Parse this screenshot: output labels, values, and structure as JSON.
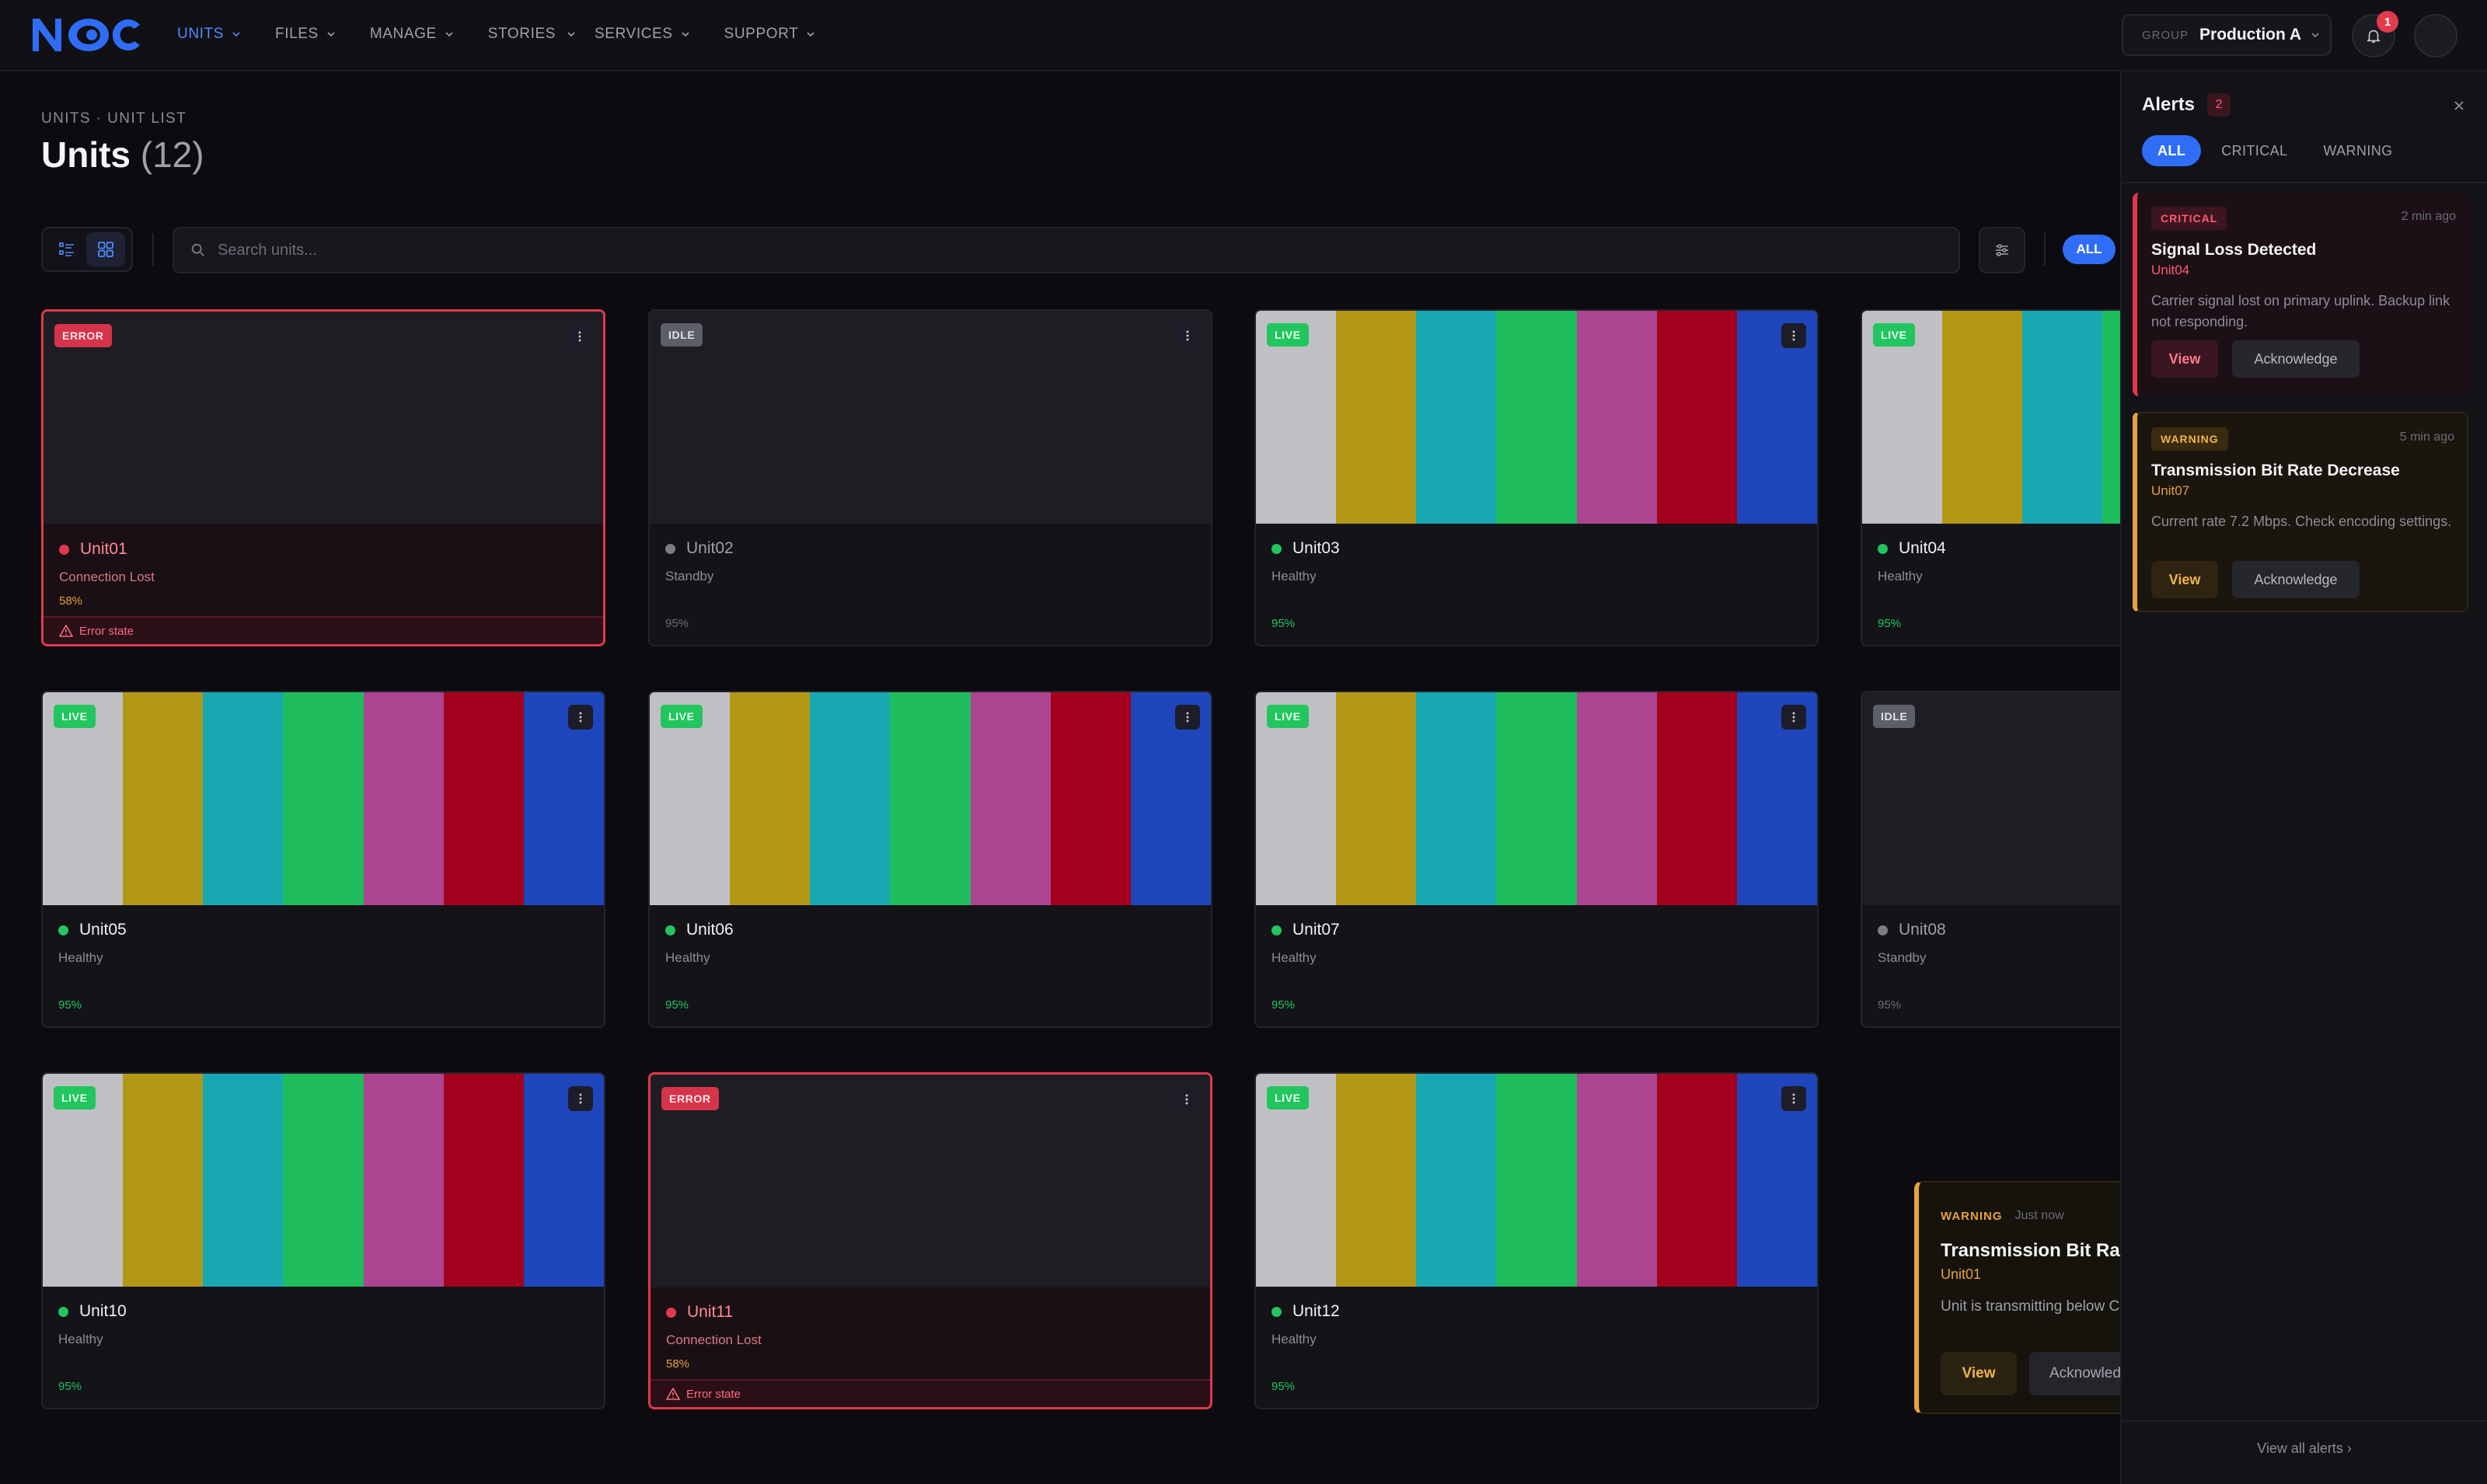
{
  "nav": {
    "logo_text": "NOC",
    "items": [
      {
        "label": "UNITS",
        "active": true
      },
      {
        "label": "FILES"
      },
      {
        "label": "MANAGE"
      },
      {
        "label": "STORIES"
      },
      {
        "label": "SERVICES"
      },
      {
        "label": "SUPPORT"
      }
    ],
    "group_label": "GROUP",
    "group_value": "Production A",
    "notification_count": "1"
  },
  "page": {
    "breadcrumb": "UNITS · UNIT LIST",
    "title": "Units",
    "count": "(12)"
  },
  "toolbar": {
    "search_placeholder": "Search units...",
    "filter_chip": "ALL"
  },
  "units": [
    {
      "name": "Unit01",
      "status": "Connection Lost",
      "pct": "58%",
      "badge": "ERROR",
      "state": "error",
      "error_text": "Error state"
    },
    {
      "name": "Unit02",
      "status": "Standby",
      "pct": "95%",
      "badge": "IDLE",
      "state": "idle"
    },
    {
      "name": "Unit03",
      "status": "Healthy",
      "pct": "95%",
      "badge": "LIVE",
      "state": "live"
    },
    {
      "name": "Unit04",
      "status": "Healthy",
      "pct": "95%",
      "badge": "LIVE",
      "state": "live"
    },
    {
      "name": "Unit05",
      "status": "Healthy",
      "pct": "95%",
      "badge": "LIVE",
      "state": "live"
    },
    {
      "name": "Unit06",
      "status": "Healthy",
      "pct": "95%",
      "badge": "LIVE",
      "state": "live"
    },
    {
      "name": "Unit07",
      "status": "Healthy",
      "pct": "95%",
      "badge": "LIVE",
      "state": "live"
    },
    {
      "name": "Unit08",
      "status": "Standby",
      "pct": "95%",
      "badge": "IDLE",
      "state": "idle"
    },
    {
      "name": "Unit10",
      "status": "Healthy",
      "pct": "95%",
      "badge": "LIVE",
      "state": "live"
    },
    {
      "name": "Unit11",
      "status": "Connection Lost",
      "pct": "58%",
      "badge": "ERROR",
      "state": "error",
      "error_text": "Error state"
    },
    {
      "name": "Unit12",
      "status": "Healthy",
      "pct": "95%",
      "badge": "LIVE",
      "state": "live"
    }
  ],
  "color_bars": [
    "#c0c0c4",
    "#b39816",
    "#17a8b3",
    "#1fbd5c",
    "#ad4491",
    "#a3001d",
    "#1f46bd"
  ],
  "toast": {
    "tag": "WARNING",
    "time": "Just now",
    "title": "Transmission Bit Rate",
    "unit": "Unit01",
    "body": "Unit is transmitting below Check connections or enc",
    "view_label": "View",
    "ack_label": "Acknowled"
  },
  "alerts": {
    "title": "Alerts",
    "count": "2",
    "tabs": [
      "ALL",
      "CRITICAL",
      "WARNING"
    ],
    "items": [
      {
        "tag": "CRITICAL",
        "time": "2 min ago",
        "title": "Signal Loss Detected",
        "unit": "Unit04",
        "body": "Carrier signal lost on primary uplink. Backup link not responding.",
        "view": "View",
        "ack": "Acknowledge"
      },
      {
        "tag": "WARNING",
        "time": "5 min ago",
        "title": "Transmission Bit Rate Decrease",
        "unit": "Unit07",
        "body": "Current rate 7.2 Mbps. Check encoding settings.",
        "view": "View",
        "ack": "Acknowledge"
      }
    ],
    "view_all": "View all alerts ›"
  }
}
